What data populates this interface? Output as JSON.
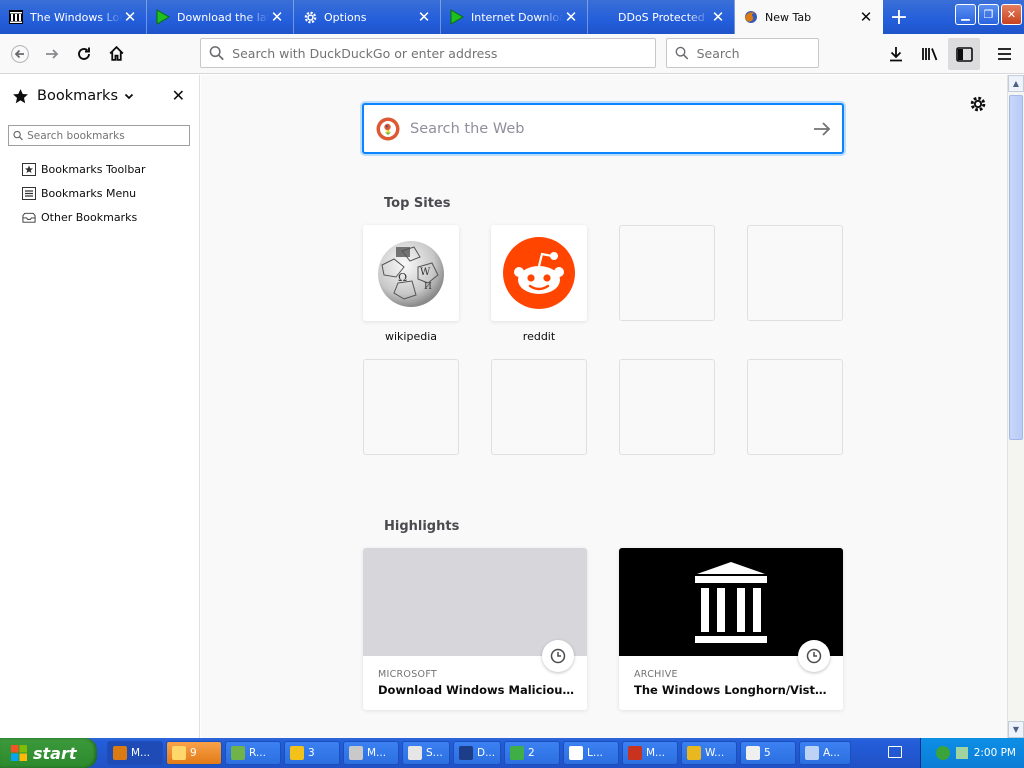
{
  "browser": {
    "tabs": [
      {
        "title": "The Windows Longhorn/Vista Archive",
        "icon": "archive-icon"
      },
      {
        "title": "Download the latest",
        "icon": "green-flag-icon"
      },
      {
        "title": "Options",
        "icon": "gear-icon"
      },
      {
        "title": "Internet Download Manager",
        "icon": "green-flag-icon"
      },
      {
        "title": "DDoS Protected Host",
        "icon": "blank-icon"
      },
      {
        "title": "New Tab",
        "icon": "firefox-icon",
        "active": true
      }
    ],
    "urlbar_placeholder": "Search with DuckDuckGo or enter address",
    "searchbar_placeholder": "Search"
  },
  "sidebar": {
    "title": "Bookmarks",
    "search_placeholder": "Search bookmarks",
    "items": [
      {
        "label": "Bookmarks Toolbar",
        "icon": "bookmarks-toolbar-icon"
      },
      {
        "label": "Bookmarks Menu",
        "icon": "bookmarks-menu-icon"
      },
      {
        "label": "Other Bookmarks",
        "icon": "folder-icon"
      }
    ]
  },
  "newtab": {
    "search_placeholder": "Search the Web",
    "top_sites_title": "Top Sites",
    "top_sites": [
      {
        "label": "wikipedia",
        "icon": "wikipedia-icon"
      },
      {
        "label": "reddit",
        "icon": "reddit-icon"
      },
      {
        "label": "",
        "icon": ""
      },
      {
        "label": "",
        "icon": ""
      },
      {
        "label": "",
        "icon": ""
      },
      {
        "label": "",
        "icon": ""
      },
      {
        "label": "",
        "icon": ""
      },
      {
        "label": "",
        "icon": ""
      }
    ],
    "highlights_title": "Highlights",
    "highlights": [
      {
        "context": "MICROSOFT",
        "title": "Download Windows Malicious So..."
      },
      {
        "context": "ARCHIVE",
        "title": "The Windows Longhorn/Vista Ar..."
      }
    ]
  },
  "taskbar": {
    "start_label": "start",
    "tasks": [
      "M...",
      "9",
      "R...",
      "3",
      "M...",
      "S...",
      "D...",
      "2",
      "L...",
      "M...",
      "W...",
      "5",
      "A..."
    ],
    "clock": "2:00 PM"
  }
}
